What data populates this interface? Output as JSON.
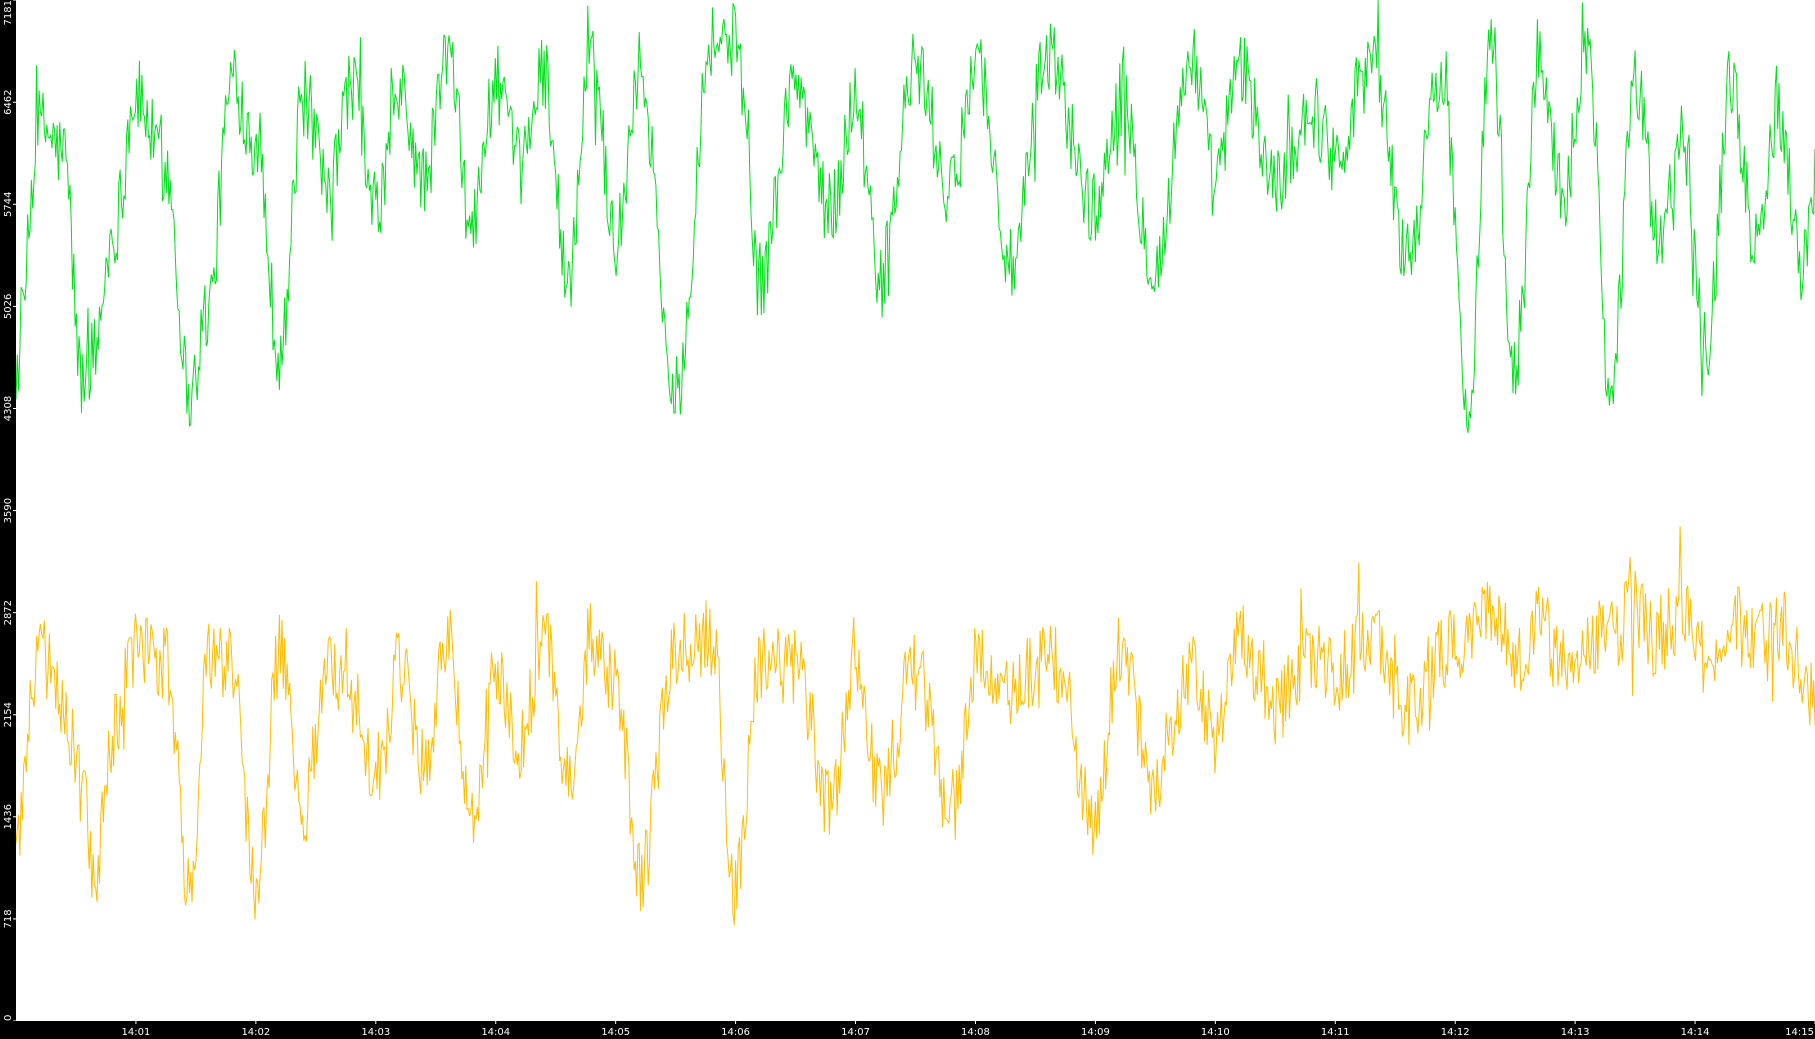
{
  "chart_data": {
    "type": "line",
    "title": "",
    "xlabel": "",
    "ylabel": "",
    "ylim": [
      0,
      7181
    ],
    "grid": false,
    "legend": "none",
    "background": "#ffffff",
    "axis_background": "#000000",
    "axis_text_color": "#ffffff",
    "y_ticks": [
      0,
      718,
      1436,
      2154,
      2872,
      3590,
      4308,
      5026,
      5744,
      6462,
      7181
    ],
    "x_range_minutes": [
      0,
      15
    ],
    "x_tick_labels": [
      "14:01",
      "14:02",
      "14:03",
      "14:04",
      "14:05",
      "14:06",
      "14:07",
      "14:08",
      "14:09",
      "14:10",
      "14:11",
      "14:12",
      "14:13",
      "14:14",
      "14:15"
    ],
    "series": [
      {
        "color": "#00e01a",
        "x_minutes": [
          0.0,
          0.2,
          0.4,
          0.55,
          0.65,
          0.8,
          1.0,
          1.25,
          1.45,
          1.6,
          1.8,
          2.0,
          2.2,
          2.4,
          2.6,
          2.8,
          3.0,
          3.2,
          3.4,
          3.6,
          3.8,
          4.0,
          4.2,
          4.4,
          4.6,
          4.8,
          5.0,
          5.2,
          5.5,
          5.8,
          6.0,
          6.2,
          6.5,
          6.8,
          7.0,
          7.2,
          7.5,
          7.8,
          8.0,
          8.3,
          8.6,
          9.0,
          9.2,
          9.5,
          9.8,
          10.0,
          10.2,
          10.5,
          10.8,
          11.0,
          11.3,
          11.6,
          11.9,
          12.1,
          12.3,
          12.5,
          12.7,
          12.9,
          13.1,
          13.3,
          13.5,
          13.7,
          13.9,
          14.1,
          14.3,
          14.5,
          14.7,
          14.9,
          15.0
        ],
        "values": [
          4600,
          6300,
          6100,
          4500,
          4700,
          5500,
          6500,
          6000,
          4400,
          5000,
          6600,
          6200,
          4700,
          6500,
          5800,
          6600,
          5700,
          6500,
          5900,
          6800,
          5600,
          6600,
          6000,
          6700,
          5200,
          6800,
          5500,
          6700,
          4400,
          6900,
          6900,
          5200,
          6600,
          5700,
          6500,
          5200,
          6700,
          5800,
          6800,
          5300,
          6800,
          5700,
          6500,
          5300,
          6800,
          5900,
          6700,
          5900,
          6400,
          6100,
          6800,
          5400,
          6700,
          4300,
          6900,
          4500,
          6800,
          5800,
          6900,
          4400,
          6600,
          5500,
          6200,
          4800,
          6600,
          5500,
          6400,
          5300,
          5900
        ]
      },
      {
        "color": "#ffbe00",
        "x_minutes": [
          0.0,
          0.2,
          0.4,
          0.55,
          0.65,
          0.8,
          1.0,
          1.25,
          1.45,
          1.6,
          1.8,
          2.0,
          2.2,
          2.4,
          2.6,
          2.8,
          3.0,
          3.2,
          3.4,
          3.6,
          3.8,
          4.0,
          4.2,
          4.4,
          4.6,
          4.8,
          5.0,
          5.2,
          5.5,
          5.8,
          6.0,
          6.2,
          6.5,
          6.8,
          7.0,
          7.2,
          7.5,
          7.8,
          8.0,
          8.3,
          8.6,
          9.0,
          9.2,
          9.5,
          9.8,
          10.0,
          10.2,
          10.5,
          10.8,
          11.0,
          11.3,
          11.6,
          11.9,
          12.1,
          12.3,
          12.5,
          12.7,
          12.9,
          13.1,
          13.3,
          13.5,
          13.7,
          13.9,
          14.1,
          14.3,
          14.5,
          14.7,
          14.9,
          15.0
        ],
        "values": [
          1300,
          2600,
          2200,
          1700,
          1000,
          2000,
          2600,
          2500,
          900,
          2600,
          2500,
          900,
          2600,
          1500,
          2500,
          2300,
          1700,
          2500,
          1800,
          2700,
          1500,
          2400,
          1900,
          2700,
          1700,
          2700,
          2400,
          1000,
          2600,
          2700,
          900,
          2500,
          2500,
          1500,
          2600,
          1600,
          2500,
          1400,
          2500,
          2300,
          2600,
          1400,
          2600,
          1600,
          2500,
          2000,
          2700,
          2200,
          2600,
          2400,
          2700,
          2200,
          2600,
          2700,
          2900,
          2500,
          2800,
          2500,
          2700,
          2700,
          2900,
          2600,
          2900,
          2500,
          2800,
          2700,
          2800,
          2500,
          2200
        ]
      }
    ]
  }
}
